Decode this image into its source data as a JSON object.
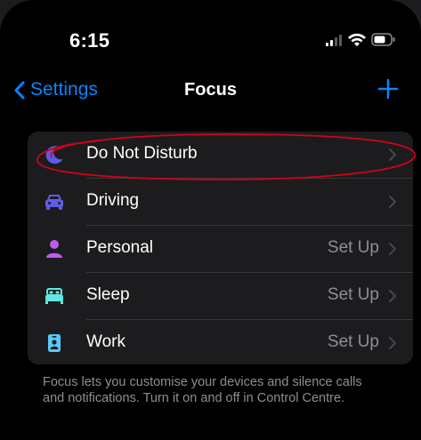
{
  "status_bar": {
    "time": "6:15"
  },
  "nav": {
    "back_label": "Settings",
    "title": "Focus",
    "add_icon": "plus-icon"
  },
  "focus_list": [
    {
      "label": "Do Not Disturb",
      "detail": "",
      "icon": "moon-icon",
      "icon_color": "#5e5ce6"
    },
    {
      "label": "Driving",
      "detail": "",
      "icon": "car-icon",
      "icon_color": "#5e5ce6"
    },
    {
      "label": "Personal",
      "detail": "Set Up",
      "icon": "person-icon",
      "icon_color": "#bf5af2"
    },
    {
      "label": "Sleep",
      "detail": "Set Up",
      "icon": "bed-icon",
      "icon_color": "#63e6e2"
    },
    {
      "label": "Work",
      "detail": "Set Up",
      "icon": "id-badge-icon",
      "icon_color": "#5ac8fa"
    }
  ],
  "footnote": "Focus lets you customise your devices and silence calls and notifications. Turn it on and off in Control Centre.",
  "colors": {
    "accent": "#0a84ff",
    "annotation": "#d0021b"
  }
}
